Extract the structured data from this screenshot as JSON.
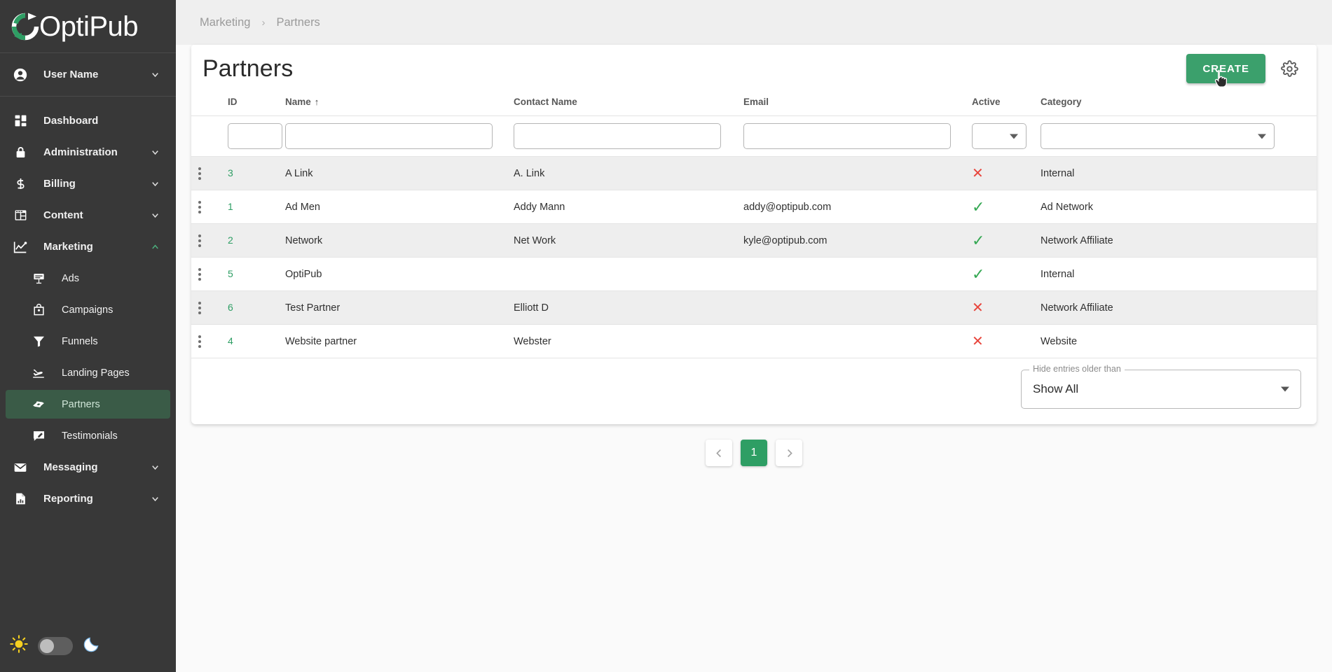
{
  "brand": {
    "name": "OptiPub",
    "logo_icon": "circular-arrow-logo",
    "accent": "#2e9e64"
  },
  "sidebar": {
    "user": {
      "label": "User Name",
      "icon": "account-circle-icon",
      "chevron": "chevron-down-icon"
    },
    "items": [
      {
        "label": "Dashboard",
        "icon": "dashboard-grid-icon",
        "expandable": false
      },
      {
        "label": "Administration",
        "icon": "lock-icon",
        "expandable": true
      },
      {
        "label": "Billing",
        "icon": "dollar-sign-icon",
        "expandable": true
      },
      {
        "label": "Content",
        "icon": "layout-page-icon",
        "expandable": true
      },
      {
        "label": "Marketing",
        "icon": "line-chart-icon",
        "expandable": true,
        "expanded": true
      },
      {
        "label": "Ads",
        "icon": "ad-sign-icon",
        "sub": true
      },
      {
        "label": "Campaigns",
        "icon": "shopping-bag-icon",
        "sub": true
      },
      {
        "label": "Funnels",
        "icon": "funnel-icon",
        "sub": true
      },
      {
        "label": "Landing Pages",
        "icon": "landing-plane-icon",
        "sub": true
      },
      {
        "label": "Partners",
        "icon": "handshake-icon",
        "sub": true,
        "active": true
      },
      {
        "label": "Testimonials",
        "icon": "comment-edit-icon",
        "sub": true
      },
      {
        "label": "Messaging",
        "icon": "envelope-icon",
        "expandable": true
      },
      {
        "label": "Reporting",
        "icon": "report-document-icon",
        "expandable": true
      }
    ],
    "theme_toggle": {
      "light_icon": "sun-icon",
      "dark_icon": "moon-icon",
      "state": "light"
    }
  },
  "breadcrumb": {
    "parent": "Marketing",
    "separator": "›",
    "current": "Partners"
  },
  "header": {
    "title": "Partners",
    "create_label": "CREATE",
    "settings_icon": "gear-icon",
    "cursor_icon": "pointer-hand-cursor"
  },
  "table": {
    "columns": [
      {
        "key": "menu",
        "label": ""
      },
      {
        "key": "id",
        "label": "ID"
      },
      {
        "key": "name",
        "label": "Name",
        "sort": "asc",
        "sort_glyph": "↑"
      },
      {
        "key": "contact",
        "label": "Contact Name"
      },
      {
        "key": "email",
        "label": "Email"
      },
      {
        "key": "active",
        "label": "Active"
      },
      {
        "key": "category",
        "label": "Category"
      }
    ],
    "filters": {
      "id": "",
      "name": "",
      "contact": "",
      "email": "",
      "active_selected": "",
      "category_selected": ""
    },
    "rows": [
      {
        "id": "3",
        "name": "A Link",
        "contact": "A. Link",
        "email": "",
        "active": false,
        "category": "Internal"
      },
      {
        "id": "1",
        "name": "Ad Men",
        "contact": "Addy Mann",
        "email": "addy@optipub.com",
        "active": true,
        "category": "Ad Network"
      },
      {
        "id": "2",
        "name": "Network",
        "contact": "Net Work",
        "email": "kyle@optipub.com",
        "active": true,
        "category": "Network Affiliate"
      },
      {
        "id": "5",
        "name": "OptiPub",
        "contact": "",
        "email": "",
        "active": true,
        "category": "Internal"
      },
      {
        "id": "6",
        "name": "Test Partner",
        "contact": "Elliott D",
        "email": "",
        "active": false,
        "category": "Network Affiliate"
      },
      {
        "id": "4",
        "name": "Website partner",
        "contact": "Webster",
        "email": "",
        "active": false,
        "category": "Website"
      }
    ],
    "active_yes_glyph": "✓",
    "active_no_glyph": "✕",
    "row_menu_icon": "vertical-dots-menu-icon"
  },
  "older_filter": {
    "label": "Hide entries older than",
    "value": "Show All",
    "icon": "chevron-down-icon"
  },
  "pagination": {
    "prev_icon": "chevron-left-icon",
    "next_icon": "chevron-right-icon",
    "pages": [
      "1"
    ],
    "current": "1"
  }
}
